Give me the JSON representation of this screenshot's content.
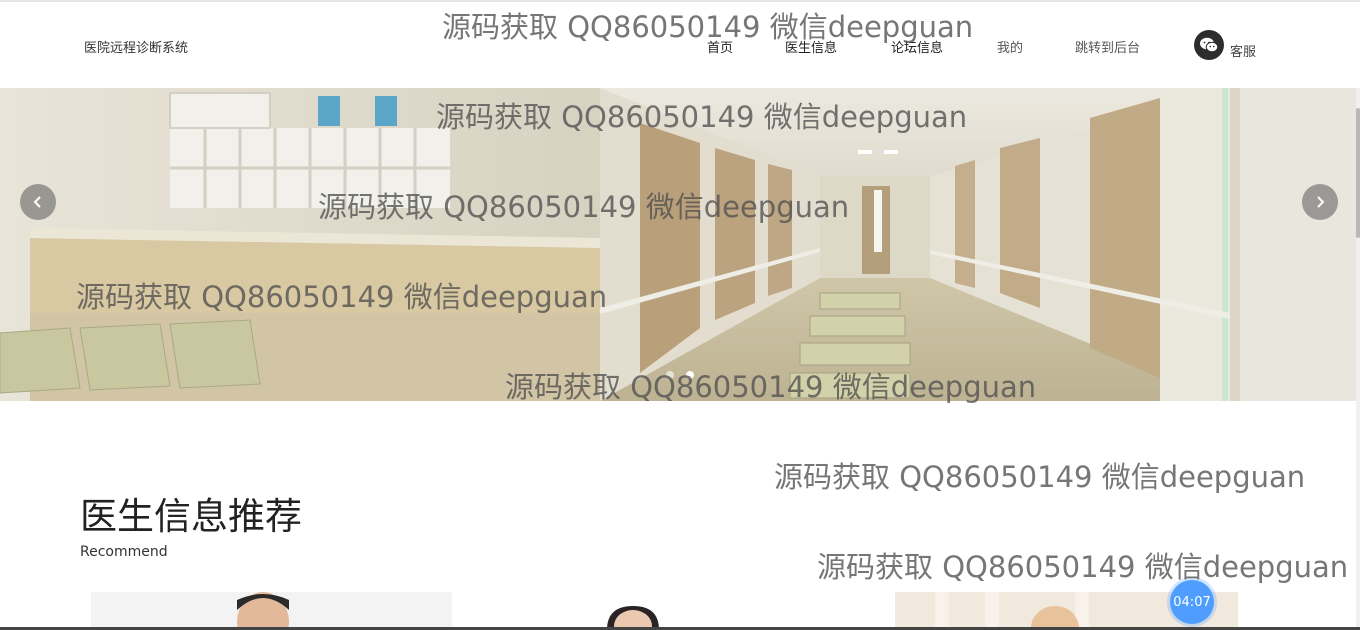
{
  "header": {
    "brand": "医院远程诊断系统",
    "nav": [
      "首页",
      "医生信息",
      "论坛信息",
      "我的",
      "跳转到后台"
    ],
    "service_label": "客服",
    "service_icon": "wechat-icon"
  },
  "banner": {
    "prev_icon": "chevron-left-icon",
    "next_icon": "chevron-right-icon",
    "dots": 2,
    "active_dot": 2
  },
  "section": {
    "title": "医生信息推荐",
    "subtitle": "Recommend"
  },
  "timer": "04:07",
  "watermark": "源码获取 QQ86050149 微信deepguan",
  "colors": {
    "timer": "#4f9dff",
    "arrow": "#5a5a5a"
  }
}
